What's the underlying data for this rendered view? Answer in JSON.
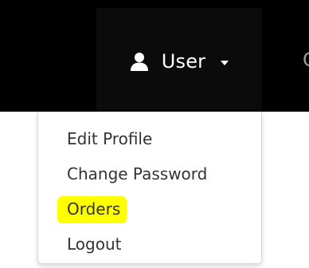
{
  "navbar": {
    "user_menu": {
      "label": "User",
      "icon": "user-icon"
    },
    "next_item_fragment": "C"
  },
  "dropdown": {
    "items": [
      {
        "label": "Edit Profile"
      },
      {
        "label": "Change Password"
      },
      {
        "label": "Orders",
        "highlighted": true,
        "highlight_color": "#ffff00"
      },
      {
        "label": "Logout"
      }
    ]
  },
  "colors": {
    "navbar_bg": "#000000",
    "nav_item_bg": "#0b0b0b",
    "text": "#333333",
    "highlight": "#ffff00"
  }
}
